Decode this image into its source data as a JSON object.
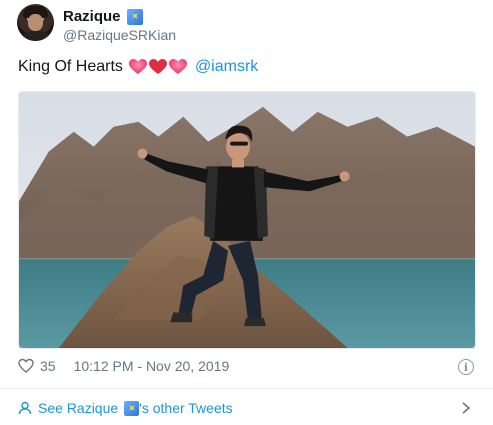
{
  "author": {
    "display_name": "Razique",
    "handle": "@RaziqueSRKian"
  },
  "tweet": {
    "text": "King Of Hearts",
    "emoji": [
      "heart-emoji-pink",
      "heart-emoji-red",
      "heart-emoji-pink"
    ],
    "mention": "@iamsrk"
  },
  "meta": {
    "likes": "35",
    "timestamp": "10:12 PM - Nov 20, 2019",
    "info_symbol": "i"
  },
  "footer": {
    "prefix": "See Razique",
    "suffix": "'s other Tweets"
  },
  "colors": {
    "link": "#1b95e0",
    "secondary_text": "#657786",
    "heart_pink": "#e8336b",
    "heart_red": "#dd2e44"
  }
}
